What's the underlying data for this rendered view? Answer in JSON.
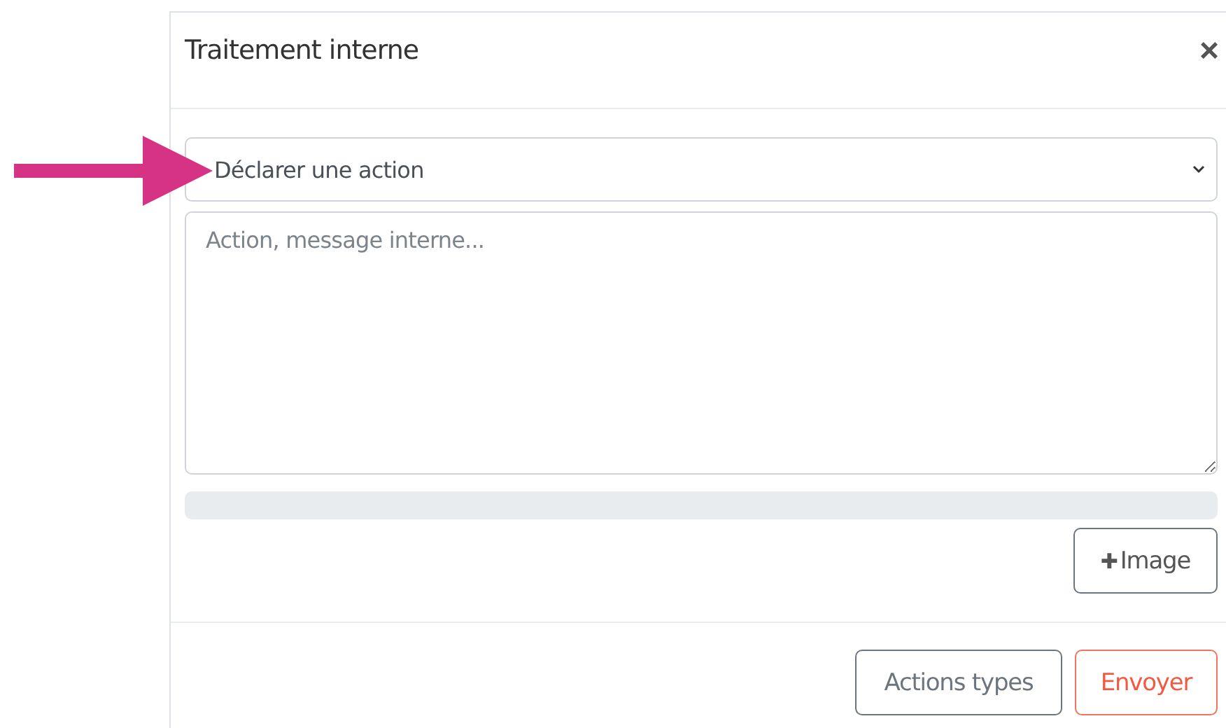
{
  "dialog": {
    "title": "Traitement interne",
    "close": "×"
  },
  "select": {
    "value": "Déclarer une action"
  },
  "message": {
    "placeholder": "Action, message interne..."
  },
  "upload_progress": {
    "level": 0
  },
  "image_button": {
    "icon": "✚",
    "label": "Image"
  },
  "buttons": [
    {
      "label": "Actions types",
      "kind": "secondary"
    },
    {
      "label": "Envoyer",
      "kind": "primary"
    }
  ]
}
